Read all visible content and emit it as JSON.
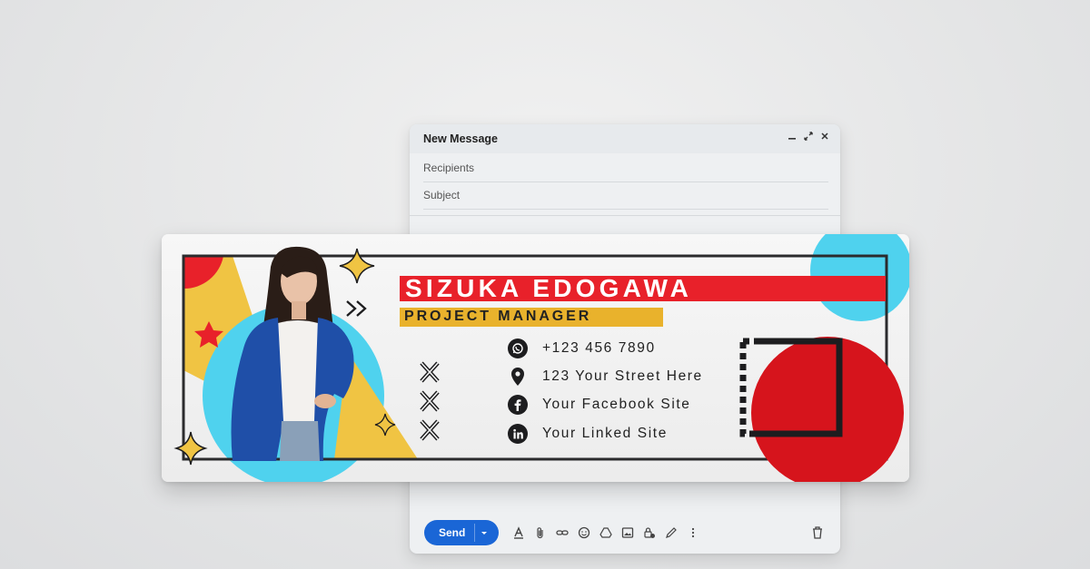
{
  "compose": {
    "title": "New Message",
    "recipients_placeholder": "Recipients",
    "subject_placeholder": "Subject",
    "send_label": "Send"
  },
  "signature": {
    "name": "SIZUKA EDOGAWA",
    "job_title": "PROJECT MANAGER",
    "contacts": [
      {
        "icon": "whatsapp-icon",
        "text": "+123 456 7890"
      },
      {
        "icon": "location-pin-icon",
        "text": "123 Your Street Here"
      },
      {
        "icon": "facebook-icon",
        "text": "Your Facebook Site"
      },
      {
        "icon": "linkedin-icon",
        "text": "Your Linked Site"
      }
    ],
    "colors": {
      "red": "#e8212a",
      "yellow": "#e9b22c",
      "cyan": "#4fd2ee",
      "blue": "#1f4fa8",
      "dark": "#1d1d1f"
    }
  }
}
